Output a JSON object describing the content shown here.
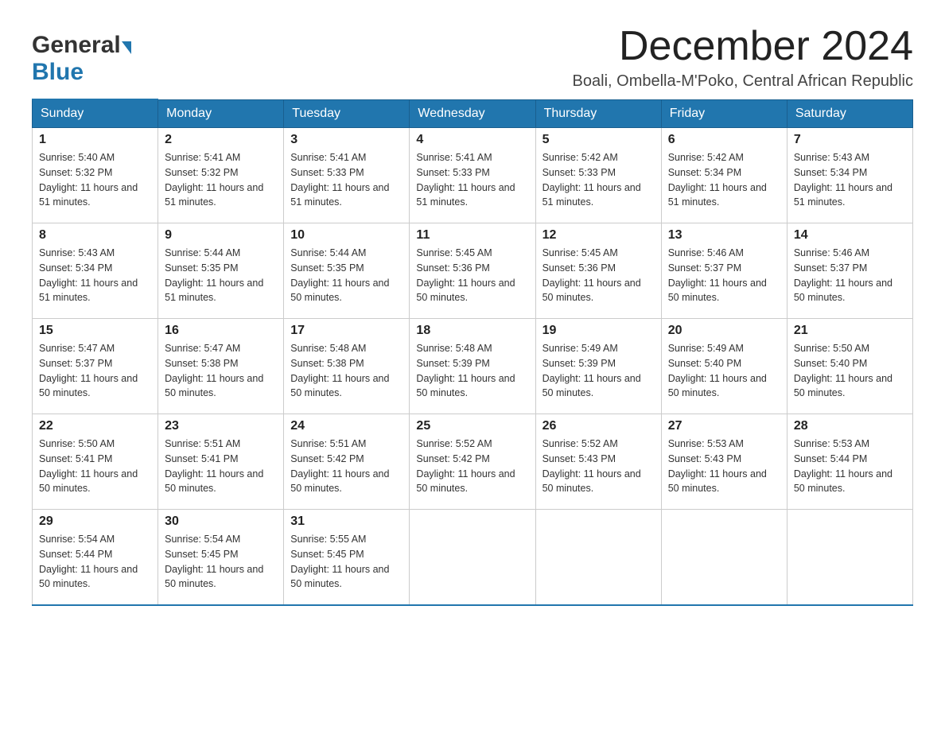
{
  "header": {
    "logo_general": "General",
    "logo_blue": "Blue",
    "month_title": "December 2024",
    "subtitle": "Boali, Ombella-M'Poko, Central African Republic"
  },
  "weekdays": [
    "Sunday",
    "Monday",
    "Tuesday",
    "Wednesday",
    "Thursday",
    "Friday",
    "Saturday"
  ],
  "weeks": [
    [
      {
        "day": "1",
        "sunrise": "5:40 AM",
        "sunset": "5:32 PM",
        "daylight": "11 hours and 51 minutes."
      },
      {
        "day": "2",
        "sunrise": "5:41 AM",
        "sunset": "5:32 PM",
        "daylight": "11 hours and 51 minutes."
      },
      {
        "day": "3",
        "sunrise": "5:41 AM",
        "sunset": "5:33 PM",
        "daylight": "11 hours and 51 minutes."
      },
      {
        "day": "4",
        "sunrise": "5:41 AM",
        "sunset": "5:33 PM",
        "daylight": "11 hours and 51 minutes."
      },
      {
        "day": "5",
        "sunrise": "5:42 AM",
        "sunset": "5:33 PM",
        "daylight": "11 hours and 51 minutes."
      },
      {
        "day": "6",
        "sunrise": "5:42 AM",
        "sunset": "5:34 PM",
        "daylight": "11 hours and 51 minutes."
      },
      {
        "day": "7",
        "sunrise": "5:43 AM",
        "sunset": "5:34 PM",
        "daylight": "11 hours and 51 minutes."
      }
    ],
    [
      {
        "day": "8",
        "sunrise": "5:43 AM",
        "sunset": "5:34 PM",
        "daylight": "11 hours and 51 minutes."
      },
      {
        "day": "9",
        "sunrise": "5:44 AM",
        "sunset": "5:35 PM",
        "daylight": "11 hours and 51 minutes."
      },
      {
        "day": "10",
        "sunrise": "5:44 AM",
        "sunset": "5:35 PM",
        "daylight": "11 hours and 50 minutes."
      },
      {
        "day": "11",
        "sunrise": "5:45 AM",
        "sunset": "5:36 PM",
        "daylight": "11 hours and 50 minutes."
      },
      {
        "day": "12",
        "sunrise": "5:45 AM",
        "sunset": "5:36 PM",
        "daylight": "11 hours and 50 minutes."
      },
      {
        "day": "13",
        "sunrise": "5:46 AM",
        "sunset": "5:37 PM",
        "daylight": "11 hours and 50 minutes."
      },
      {
        "day": "14",
        "sunrise": "5:46 AM",
        "sunset": "5:37 PM",
        "daylight": "11 hours and 50 minutes."
      }
    ],
    [
      {
        "day": "15",
        "sunrise": "5:47 AM",
        "sunset": "5:37 PM",
        "daylight": "11 hours and 50 minutes."
      },
      {
        "day": "16",
        "sunrise": "5:47 AM",
        "sunset": "5:38 PM",
        "daylight": "11 hours and 50 minutes."
      },
      {
        "day": "17",
        "sunrise": "5:48 AM",
        "sunset": "5:38 PM",
        "daylight": "11 hours and 50 minutes."
      },
      {
        "day": "18",
        "sunrise": "5:48 AM",
        "sunset": "5:39 PM",
        "daylight": "11 hours and 50 minutes."
      },
      {
        "day": "19",
        "sunrise": "5:49 AM",
        "sunset": "5:39 PM",
        "daylight": "11 hours and 50 minutes."
      },
      {
        "day": "20",
        "sunrise": "5:49 AM",
        "sunset": "5:40 PM",
        "daylight": "11 hours and 50 minutes."
      },
      {
        "day": "21",
        "sunrise": "5:50 AM",
        "sunset": "5:40 PM",
        "daylight": "11 hours and 50 minutes."
      }
    ],
    [
      {
        "day": "22",
        "sunrise": "5:50 AM",
        "sunset": "5:41 PM",
        "daylight": "11 hours and 50 minutes."
      },
      {
        "day": "23",
        "sunrise": "5:51 AM",
        "sunset": "5:41 PM",
        "daylight": "11 hours and 50 minutes."
      },
      {
        "day": "24",
        "sunrise": "5:51 AM",
        "sunset": "5:42 PM",
        "daylight": "11 hours and 50 minutes."
      },
      {
        "day": "25",
        "sunrise": "5:52 AM",
        "sunset": "5:42 PM",
        "daylight": "11 hours and 50 minutes."
      },
      {
        "day": "26",
        "sunrise": "5:52 AM",
        "sunset": "5:43 PM",
        "daylight": "11 hours and 50 minutes."
      },
      {
        "day": "27",
        "sunrise": "5:53 AM",
        "sunset": "5:43 PM",
        "daylight": "11 hours and 50 minutes."
      },
      {
        "day": "28",
        "sunrise": "5:53 AM",
        "sunset": "5:44 PM",
        "daylight": "11 hours and 50 minutes."
      }
    ],
    [
      {
        "day": "29",
        "sunrise": "5:54 AM",
        "sunset": "5:44 PM",
        "daylight": "11 hours and 50 minutes."
      },
      {
        "day": "30",
        "sunrise": "5:54 AM",
        "sunset": "5:45 PM",
        "daylight": "11 hours and 50 minutes."
      },
      {
        "day": "31",
        "sunrise": "5:55 AM",
        "sunset": "5:45 PM",
        "daylight": "11 hours and 50 minutes."
      },
      null,
      null,
      null,
      null
    ]
  ]
}
